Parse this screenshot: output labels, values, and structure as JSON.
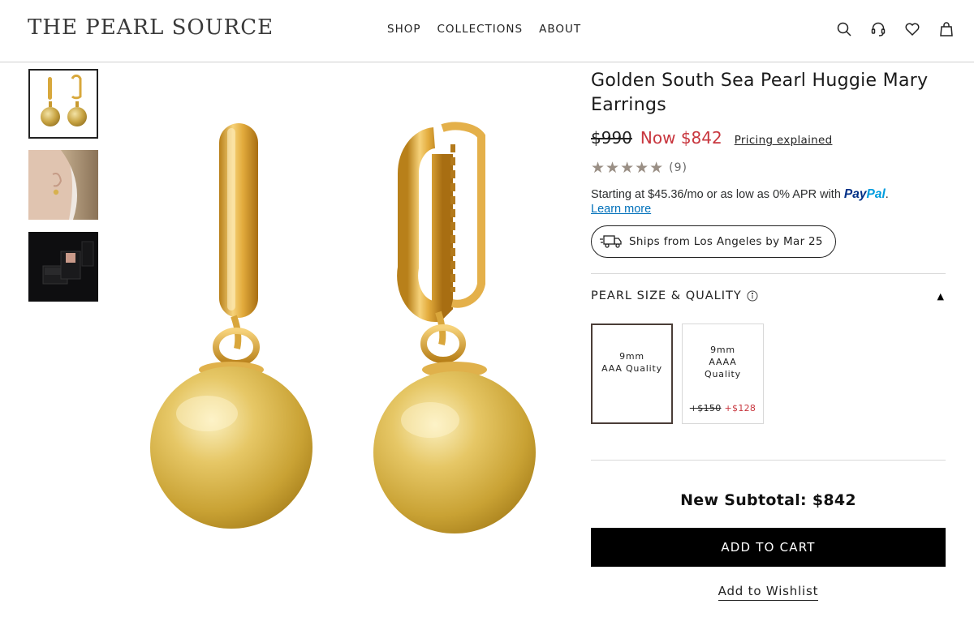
{
  "brand": {
    "logo_text": "THE PEARL SOURCE"
  },
  "nav": {
    "items": [
      {
        "label": "SHOP"
      },
      {
        "label": "COLLECTIONS"
      },
      {
        "label": "ABOUT"
      }
    ]
  },
  "header_icons": [
    "search-icon",
    "support-headset-icon",
    "heart-icon",
    "shopping-bag-icon"
  ],
  "gallery": {
    "thumbnails": [
      {
        "name": "thumbnail-earrings-pair",
        "selected": true
      },
      {
        "name": "thumbnail-model-wearing"
      },
      {
        "name": "thumbnail-gift-box"
      }
    ]
  },
  "product": {
    "title": "Golden South Sea Pearl Huggie Mary Earrings",
    "old_price": "$990",
    "now_price": "Now $842",
    "pricing_link": "Pricing explained",
    "rating": {
      "stars": 5,
      "stars_text": "★★★★★",
      "count": "(9)"
    },
    "financing": {
      "text": "Starting at $45.36/mo or as low as 0% APR with ",
      "provider_pay": "Pay",
      "provider_pal": "Pal",
      "period": ".",
      "learn_more": "Learn more"
    },
    "shipping": "Ships from Los Angeles by Mar 25"
  },
  "options": {
    "label": "PEARL SIZE & QUALITY",
    "collapse_glyph": "▲",
    "items": [
      {
        "line1": "9mm",
        "line2": "AAA Quality",
        "selected": true
      },
      {
        "line1": "9mm",
        "line2": "AAAA",
        "line3": "Quality",
        "old_price": "+$150",
        "new_price": "+$128",
        "selected": false
      }
    ]
  },
  "cart": {
    "subtotal": "New Subtotal: $842",
    "add_to_cart": "ADD TO CART",
    "wishlist": "Add to Wishlist"
  },
  "colors": {
    "sale_red": "#c8363e",
    "paypal_blue": "#003087",
    "paypal_light": "#009cde",
    "gold": "#d4a93a"
  }
}
